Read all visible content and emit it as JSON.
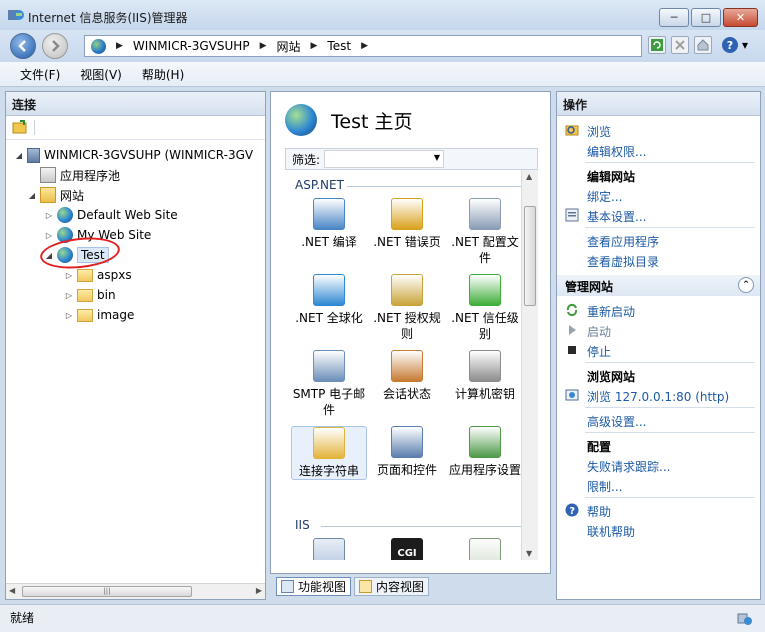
{
  "window": {
    "title": "Internet 信息服务(IIS)管理器",
    "min": "─",
    "max": "□",
    "close": "✕"
  },
  "address": {
    "crumbs": [
      "WINMICR-3GVSUHP",
      "网站",
      "Test"
    ],
    "separator": "▶"
  },
  "toolbar": {
    "help": "?",
    "help_caret": "▾"
  },
  "menu": [
    "文件(F)",
    "视图(V)",
    "帮助(H)"
  ],
  "left_panel": {
    "header": "连接",
    "tree": [
      {
        "label": "WINMICR-3GVSUHP (WINMICR-3GV",
        "icon": "server-icon"
      },
      {
        "label": "应用程序池",
        "icon": "app-pool-icon"
      },
      {
        "label": "网站",
        "icon": "sites-folder-icon"
      },
      {
        "label": "Default Web Site",
        "icon": "globe-icon"
      },
      {
        "label": "My Web Site",
        "icon": "globe-icon"
      },
      {
        "label": "Test",
        "icon": "globe-icon"
      },
      {
        "label": "aspxs",
        "icon": "folder-icon"
      },
      {
        "label": "bin",
        "icon": "folder-icon"
      },
      {
        "label": "image",
        "icon": "folder-icon"
      }
    ],
    "scroll_thumb": "|||"
  },
  "center": {
    "title": "Test 主页",
    "filter_label": "筛选:",
    "groups": [
      "ASP.NET",
      "IIS"
    ],
    "features": [
      {
        "label": ".NET 编译",
        "color": "#4a86c5"
      },
      {
        "label": ".NET 错误页",
        "color": "#d9a21c"
      },
      {
        "label": ".NET 配置文件",
        "color": "#8a9cb5"
      },
      {
        "label": ".NET 全球化",
        "color": "#2f89d3"
      },
      {
        "label": ".NET 授权规则",
        "color": "#c9a43a"
      },
      {
        "label": ".NET 信任级别",
        "color": "#3fae3a"
      },
      {
        "label": "SMTP 电子邮件",
        "color": "#6c8fb9"
      },
      {
        "label": "会话状态",
        "color": "#c77b33"
      },
      {
        "label": "计算机密钥",
        "color": "#8c8c8c"
      },
      {
        "label": "连接字符串",
        "color": "#e3b43c"
      },
      {
        "label": "页面和控件",
        "color": "#5b7fae"
      },
      {
        "label": "应用程序设置",
        "color": "#4f9a4a"
      }
    ],
    "iis_features": [
      {
        "icon": "asp-icon",
        "color": "#3c74b8"
      },
      {
        "label": "CGI",
        "color": "#1c1c1c"
      },
      {
        "icon": "default-doc-icon",
        "color": "#3a9a4b"
      }
    ],
    "view_tabs": [
      "功能视图",
      "内容视图"
    ]
  },
  "right_panel": {
    "header": "操作",
    "items_top": [
      {
        "label": "浏览",
        "icon": "explore-icon"
      },
      {
        "label": "编辑权限..."
      }
    ],
    "edit_site_header": "编辑网站",
    "edit_site": [
      {
        "label": "绑定..."
      },
      {
        "label": "基本设置...",
        "icon": "basic-settings-icon"
      },
      {
        "label": "查看应用程序"
      },
      {
        "label": "查看虚拟目录"
      }
    ],
    "manage_header": "管理网站",
    "manage": [
      {
        "label": "重新启动",
        "icon": "restart-icon"
      },
      {
        "label": "启动",
        "icon": "start-icon"
      },
      {
        "label": "停止",
        "icon": "stop-icon"
      }
    ],
    "browse_header": "浏览网站",
    "browse_link": "浏览 127.0.0.1:80 (http)",
    "advanced": "高级设置...",
    "config_header": "配置",
    "config": [
      "失败请求跟踪...",
      "限制..."
    ],
    "help": "帮助",
    "online_help": "联机帮助",
    "collapse": "⌃"
  },
  "status": "就绪"
}
